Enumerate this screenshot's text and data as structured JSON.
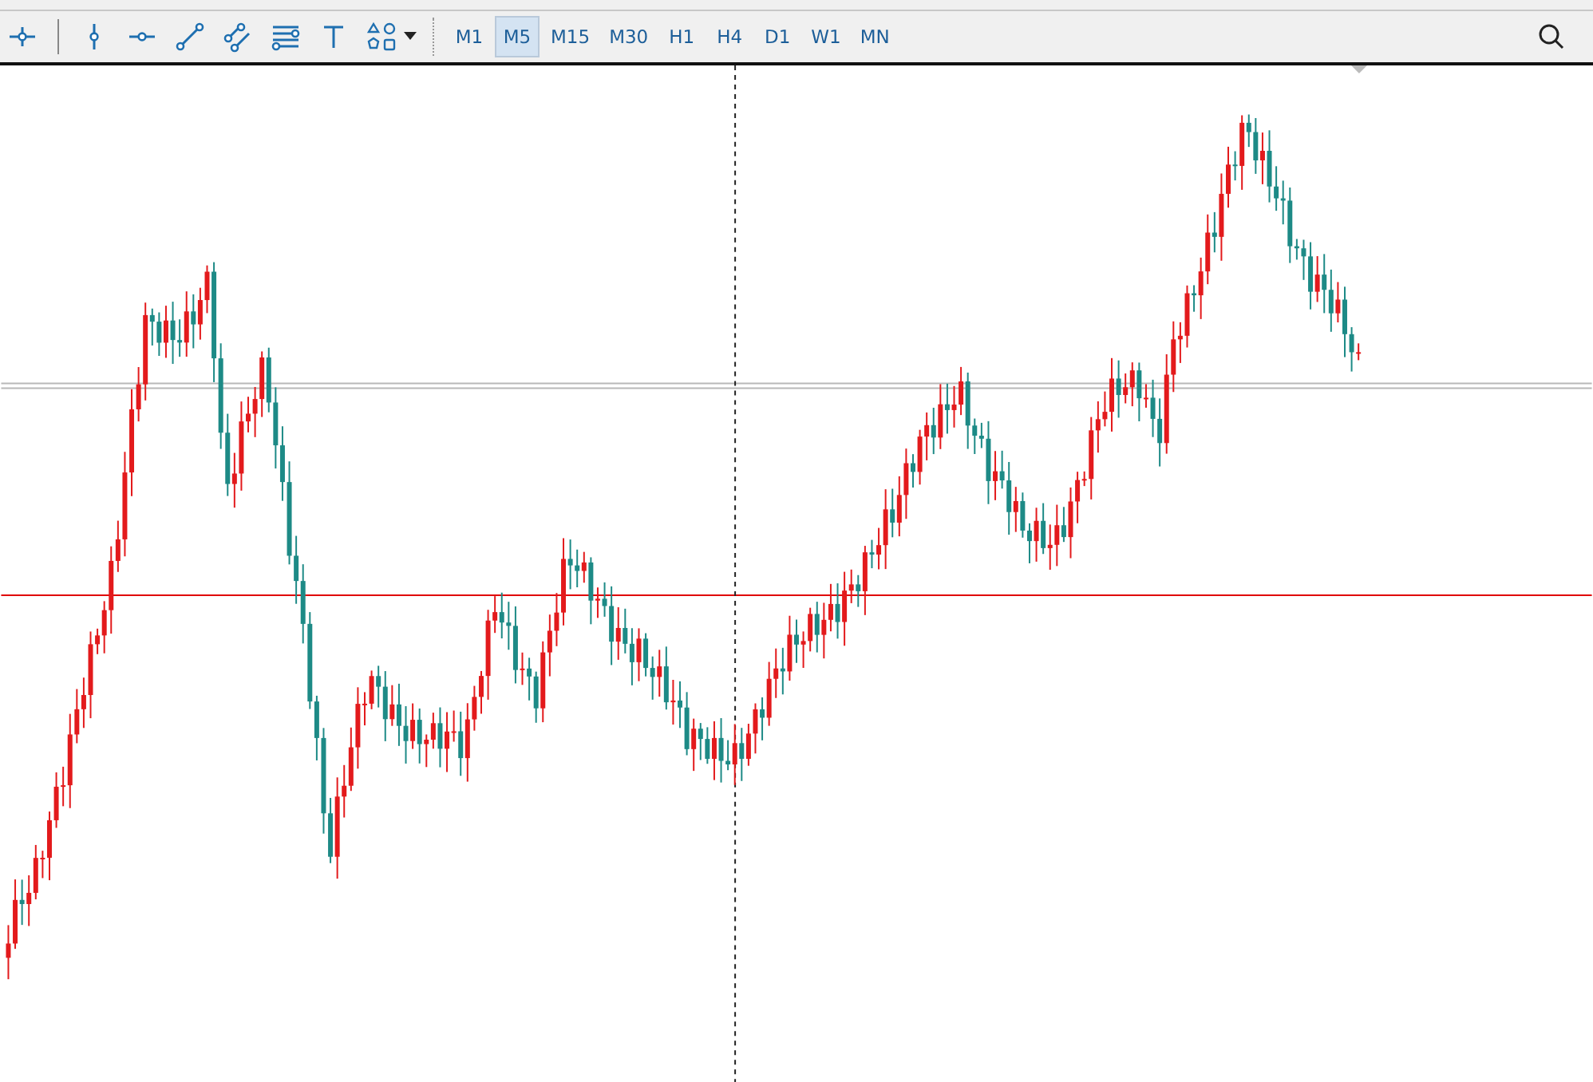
{
  "timeframes": [
    {
      "label": "M1",
      "selected": false
    },
    {
      "label": "M5",
      "selected": true
    },
    {
      "label": "M15",
      "selected": false
    },
    {
      "label": "M30",
      "selected": false
    },
    {
      "label": "H1",
      "selected": false
    },
    {
      "label": "H4",
      "selected": false
    },
    {
      "label": "D1",
      "selected": false
    },
    {
      "label": "W1",
      "selected": false
    },
    {
      "label": "MN",
      "selected": false
    }
  ]
}
